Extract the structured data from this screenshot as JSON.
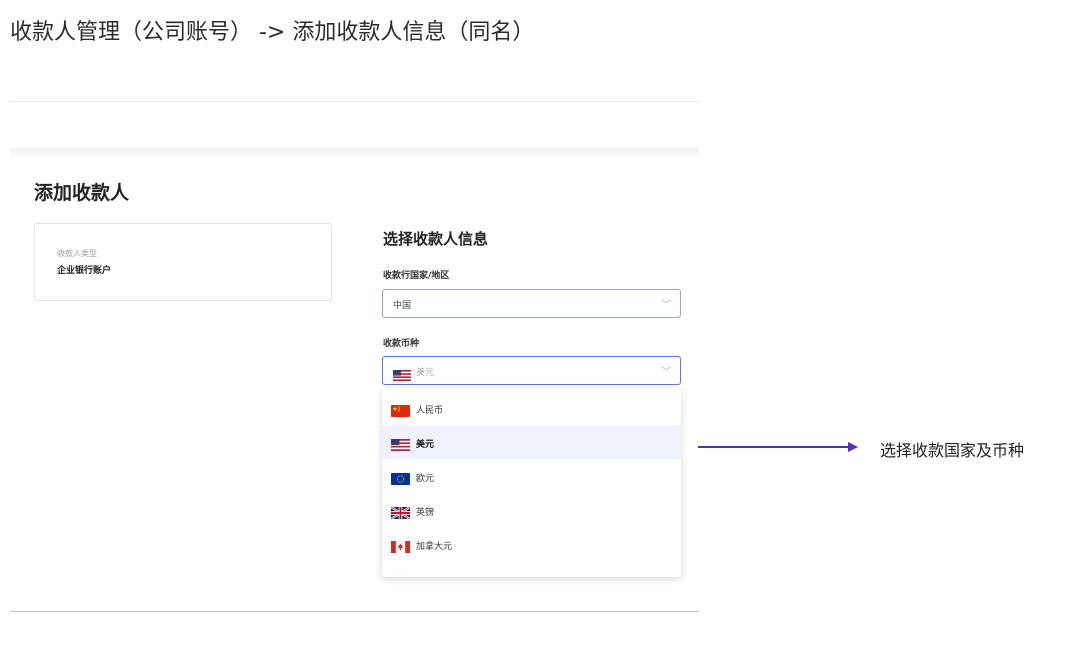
{
  "doc": {
    "title": "收款人管理（公司账号） -> 添加收款人信息（同名）"
  },
  "page": {
    "heading": "添加收款人"
  },
  "payee_type_card": {
    "caption": "收款人类型",
    "value": "企业银行账户"
  },
  "form": {
    "section_title": "选择收款人信息",
    "country_label": "收款行国家/地区",
    "country_value": "中国",
    "currency_label": "收款币种",
    "currency_value": "美元",
    "currency_flag": "us-flag-icon"
  },
  "currency_options": [
    {
      "label": "人民币",
      "flag": "cn-flag-icon",
      "selected": false
    },
    {
      "label": "美元",
      "flag": "us-flag-icon",
      "selected": true
    },
    {
      "label": "欧元",
      "flag": "eu-flag-icon",
      "selected": false
    },
    {
      "label": "英镑",
      "flag": "uk-flag-icon",
      "selected": false
    },
    {
      "label": "加拿大元",
      "flag": "ca-flag-icon",
      "selected": false
    }
  ],
  "annotation": {
    "text": "选择收款国家及币种",
    "color": "#5b2ab8"
  },
  "colors": {
    "select_border": "#5b78de",
    "active_option_bg": "#eef3fb"
  }
}
